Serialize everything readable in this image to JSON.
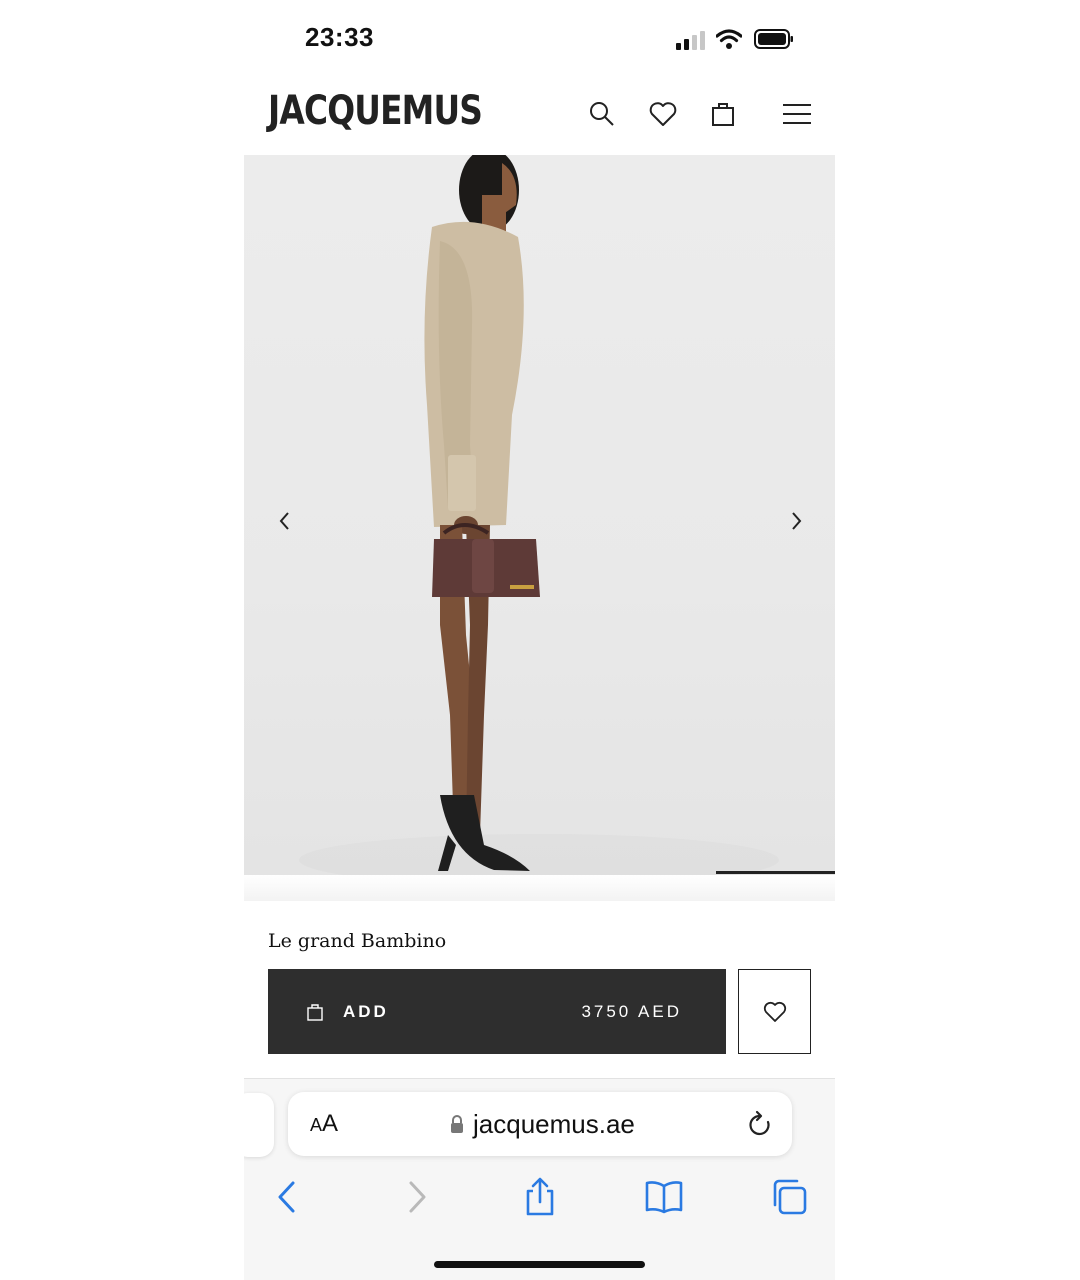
{
  "status_bar": {
    "time": "23:33"
  },
  "header": {
    "brand": "JACQUEMUS",
    "icons": [
      "search-icon",
      "heart-icon",
      "bag-icon",
      "menu-icon"
    ]
  },
  "product": {
    "name": "Le grand Bambino",
    "add_label": "ADD",
    "price": "3750 AED"
  },
  "browser": {
    "text_size_label_small": "A",
    "text_size_label_large": "A",
    "url": "jacquemus.ae"
  },
  "colors": {
    "add_bar": "#2e2e2e",
    "bag_color": "#5e3a37",
    "ios_blue": "#2a7ae2"
  }
}
